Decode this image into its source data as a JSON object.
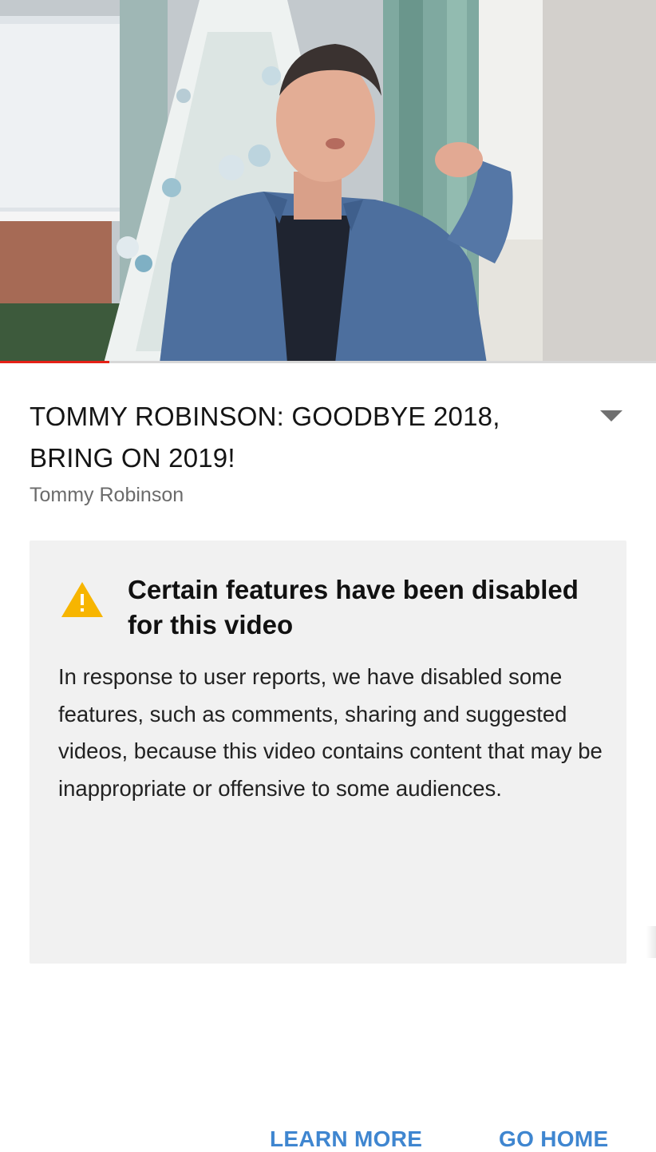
{
  "video": {
    "progress_fraction": 0.167,
    "progress_color": "#e62117",
    "thumbnail_description_icon": "video-frame"
  },
  "title": {
    "text": "TOMMY ROBINSON: GOODBYE 2018, BRING ON 2019!",
    "expand_icon": "chevron-down-icon"
  },
  "channel": {
    "name": "Tommy Robinson"
  },
  "notice": {
    "icon": "warning-icon",
    "title": "Certain features have been disabled for this video",
    "body": "In response to user reports, we have disabled some features, such as comments, sharing and suggested videos, because this video contains content that may be inappropriate or offensive to some audiences.",
    "learn_more_label": "LEARN MORE",
    "go_home_label": "GO HOME",
    "accent_color": "#3f86d0",
    "warning_color": "#f7b500"
  }
}
